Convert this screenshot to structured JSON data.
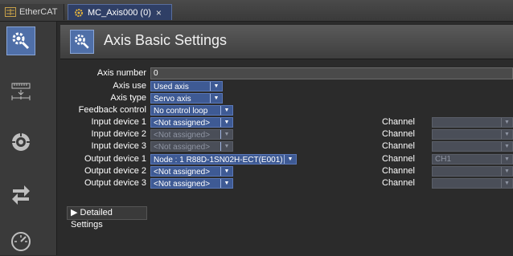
{
  "tabs": [
    {
      "label": "EtherCAT"
    },
    {
      "label": "MC_Axis000 (0)",
      "close": "×"
    }
  ],
  "header": {
    "title": "Axis Basic Settings"
  },
  "form": {
    "axis_number": {
      "label": "Axis number",
      "value": "0"
    },
    "axis_use": {
      "label": "Axis use",
      "value": "Used axis"
    },
    "axis_type": {
      "label": "Axis type",
      "value": "Servo axis"
    },
    "feedback_control": {
      "label": "Feedback control",
      "value": "No control loop"
    },
    "input_device_1": {
      "label": "Input device 1",
      "value": "<Not assigned>",
      "channel_label": "Channel",
      "channel_value": ""
    },
    "input_device_2": {
      "label": "Input device 2",
      "value": "<Not assigned>",
      "channel_label": "Channel",
      "channel_value": ""
    },
    "input_device_3": {
      "label": "Input device 3",
      "value": "<Not assigned>",
      "channel_label": "Channel",
      "channel_value": ""
    },
    "output_device_1": {
      "label": "Output device 1",
      "value": "Node : 1 R88D-1SN02H-ECT(E001)",
      "channel_label": "Channel",
      "channel_value": "CH1"
    },
    "output_device_2": {
      "label": "Output device 2",
      "value": "<Not assigned>",
      "channel_label": "Channel",
      "channel_value": ""
    },
    "output_device_3": {
      "label": "Output device 3",
      "value": "<Not assigned>",
      "channel_label": "Channel",
      "channel_value": ""
    }
  },
  "detailed_settings": {
    "label": "Detailed Settings",
    "arrow": "▶"
  },
  "dropdown_arrow": "▼",
  "colors": {
    "accent": "#4f6fa8",
    "dropdown": "#3e5a94",
    "background": "#2b2b2b"
  }
}
